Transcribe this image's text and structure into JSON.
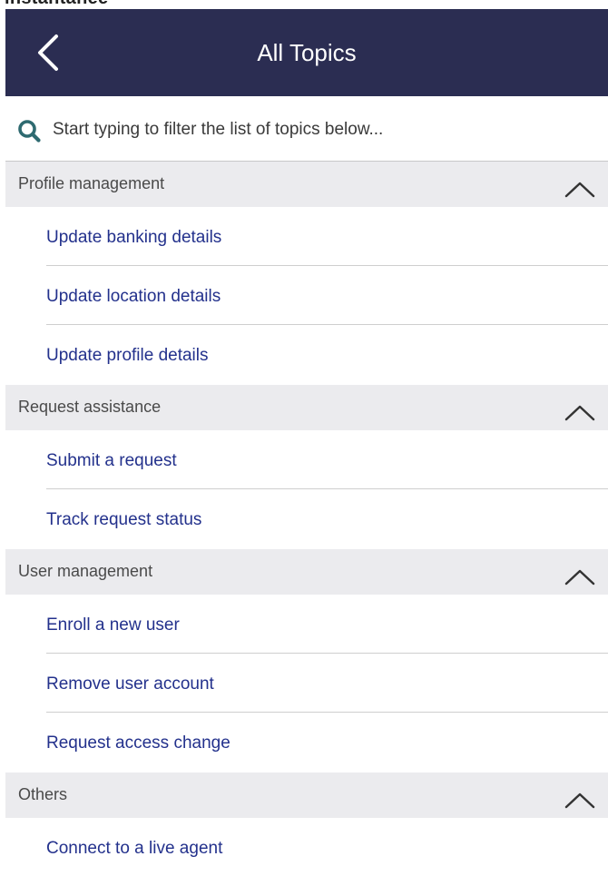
{
  "app": {
    "clipped_heading": "instantanée"
  },
  "header": {
    "title": "All Topics",
    "back_icon": "chevron-left-icon",
    "background_color": "#2b2d52"
  },
  "search": {
    "placeholder": "Start typing to filter the list of topics below...",
    "value": "",
    "icon": "search-icon",
    "icon_color": "#2e6a70"
  },
  "sections": [
    {
      "title": "Profile management",
      "expanded": true,
      "items": [
        {
          "label": "Update banking details"
        },
        {
          "label": "Update location details"
        },
        {
          "label": "Update profile details"
        }
      ]
    },
    {
      "title": "Request assistance",
      "expanded": true,
      "items": [
        {
          "label": "Submit a request"
        },
        {
          "label": "Track request status"
        }
      ]
    },
    {
      "title": "User management",
      "expanded": true,
      "items": [
        {
          "label": "Enroll a new user"
        },
        {
          "label": "Remove user account"
        },
        {
          "label": "Request access change"
        }
      ]
    },
    {
      "title": "Others",
      "expanded": true,
      "items": [
        {
          "label": "Connect to a live agent"
        }
      ]
    }
  ],
  "colors": {
    "link": "#23318c",
    "section_bg": "#ebebee",
    "section_text": "#4a4a4a"
  }
}
